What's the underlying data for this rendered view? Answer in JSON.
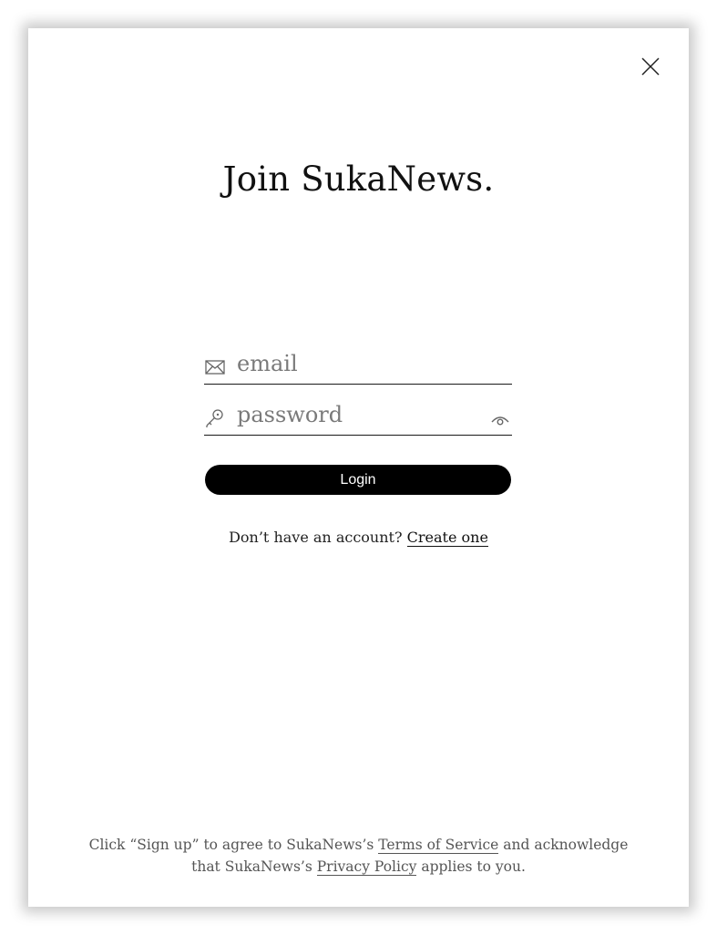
{
  "modal": {
    "close_icon": "close-icon",
    "title": "Join SukaNews."
  },
  "form": {
    "email": {
      "icon": "mail-icon",
      "placeholder": "email",
      "value": ""
    },
    "password": {
      "icon": "key-icon",
      "placeholder": "password",
      "value": "",
      "toggle_icon": "eye-icon"
    },
    "login_label": "Login"
  },
  "signup": {
    "prompt": "Don’t have an account?",
    "link": "Create one"
  },
  "legal": {
    "part1": "Click “Sign up” to agree to SukaNews’s",
    "terms_link": "Terms of Service",
    "part2": "and acknowledge",
    "part3": "that SukaNews’s",
    "privacy_link": "Privacy Policy",
    "part4": "applies to you."
  },
  "colors": {
    "button_bg": "#000000",
    "button_text": "#ffffff",
    "placeholder": "#7a7a7a",
    "legal_text": "#555555"
  }
}
